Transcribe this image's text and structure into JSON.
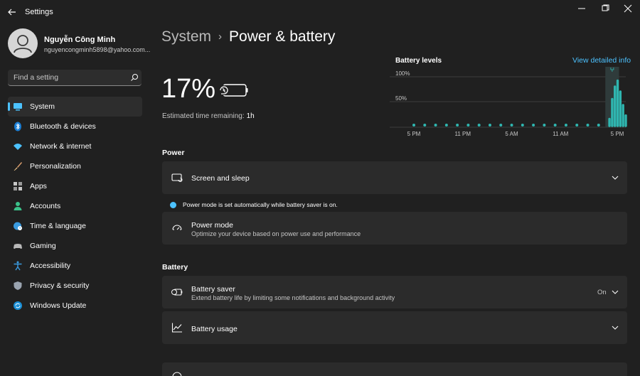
{
  "window": {
    "title": "Settings",
    "minimize_icon": "minimize-icon",
    "maximize_icon": "maximize-icon",
    "close_icon": "close-icon"
  },
  "user": {
    "name": "Nguyễn Công Minh",
    "email": "nguyencongminh5898@yahoo.com..."
  },
  "search": {
    "placeholder": "Find a setting",
    "icon": "search-icon"
  },
  "sidebar": {
    "accent_color": "#4cc2ff",
    "items": [
      {
        "label": "System",
        "icon": "system-icon",
        "selected": true
      },
      {
        "label": "Bluetooth & devices",
        "icon": "bluetooth-icon"
      },
      {
        "label": "Network & internet",
        "icon": "wifi-icon"
      },
      {
        "label": "Personalization",
        "icon": "brush-icon"
      },
      {
        "label": "Apps",
        "icon": "apps-icon"
      },
      {
        "label": "Accounts",
        "icon": "accounts-icon"
      },
      {
        "label": "Time & language",
        "icon": "globe-clock-icon"
      },
      {
        "label": "Gaming",
        "icon": "gamepad-icon"
      },
      {
        "label": "Accessibility",
        "icon": "accessibility-icon"
      },
      {
        "label": "Privacy & security",
        "icon": "shield-icon"
      },
      {
        "label": "Windows Update",
        "icon": "update-icon"
      }
    ]
  },
  "breadcrumb": {
    "parent": "System",
    "separator": "›",
    "current": "Power & battery"
  },
  "battery": {
    "percent": "17%",
    "estimate_label": "Estimated time remaining:",
    "estimate_value": "1h"
  },
  "chart": {
    "title": "Battery levels",
    "link": "View detailed info",
    "bar_color": "#2fb6b0",
    "dot_color": "#2fb6b0"
  },
  "chart_data": {
    "type": "bar",
    "title": "Battery levels",
    "y_ticks": [
      "100%",
      "50%"
    ],
    "ylim": [
      0,
      100
    ],
    "x_ticks": [
      "5 PM",
      "11 PM",
      "5 AM",
      "11 AM",
      "5 PM"
    ],
    "values": [
      0,
      0,
      0,
      0,
      0,
      0,
      0,
      0,
      0,
      0,
      0,
      0,
      0,
      0,
      0,
      0,
      0,
      0,
      0,
      0,
      0,
      0,
      0,
      0,
      0,
      0,
      0,
      0,
      0,
      0,
      0,
      0,
      0,
      0,
      0,
      0,
      0,
      0,
      0,
      0,
      0,
      0,
      0,
      0,
      0,
      0,
      0,
      0,
      0,
      0,
      0,
      0,
      0,
      0,
      0,
      0,
      0,
      0,
      0,
      0,
      0,
      0,
      0,
      0,
      0,
      0,
      0,
      0,
      0,
      0,
      0,
      0,
      15,
      55,
      80,
      92,
      70,
      43,
      22
    ],
    "grid": true
  },
  "power_section": {
    "title": "Power",
    "screen_sleep": {
      "title": "Screen and sleep",
      "icon": "screen-sleep-icon",
      "chevron": "chevron-down-icon"
    },
    "info": "Power mode is set automatically while battery saver is on.",
    "power_mode": {
      "title": "Power mode",
      "subtitle": "Optimize your device based on power use and performance",
      "icon": "power-mode-icon"
    }
  },
  "battery_section": {
    "title": "Battery",
    "battery_saver": {
      "title": "Battery saver",
      "subtitle": "Extend battery life by limiting some notifications and background activity",
      "value": "On",
      "icon": "battery-saver-icon",
      "chevron": "chevron-down-icon"
    },
    "battery_usage": {
      "title": "Battery usage",
      "icon": "chart-line-icon",
      "chevron": "chevron-down-icon"
    }
  }
}
